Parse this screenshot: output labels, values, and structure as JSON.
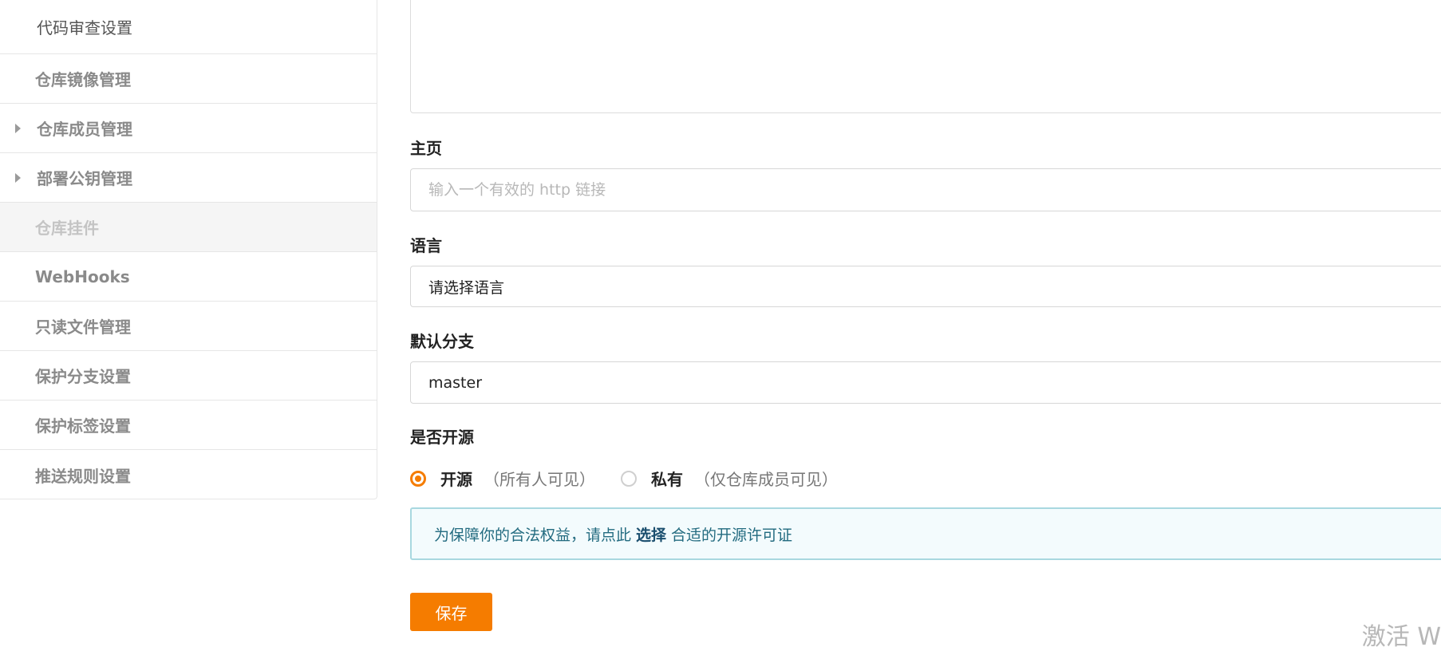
{
  "sidebar": {
    "items": [
      {
        "label": "代码审查设置"
      },
      {
        "label": "仓库镜像管理"
      },
      {
        "label": "仓库成员管理"
      },
      {
        "label": "部署公钥管理"
      },
      {
        "label": "仓库挂件"
      },
      {
        "label": "WebHooks"
      },
      {
        "label": "只读文件管理"
      },
      {
        "label": "保护分支设置"
      },
      {
        "label": "保护标签设置"
      },
      {
        "label": "推送规则设置"
      }
    ]
  },
  "form": {
    "homepage": {
      "label": "主页",
      "placeholder": "输入一个有效的 http 链接"
    },
    "language": {
      "label": "语言",
      "value": "请选择语言"
    },
    "default_branch": {
      "label": "默认分支",
      "value": "master"
    },
    "open_source": {
      "label": "是否开源",
      "options": [
        {
          "label": "开源",
          "hint": "（所有人可见）"
        },
        {
          "label": "私有",
          "hint": "（仅仓库成员可见）"
        }
      ]
    },
    "notice": {
      "before": "为保障你的合法权益，请点此",
      "link": "选择",
      "after": "合适的开源许可证"
    },
    "save_label": "保存"
  },
  "watermark": "激活 W"
}
